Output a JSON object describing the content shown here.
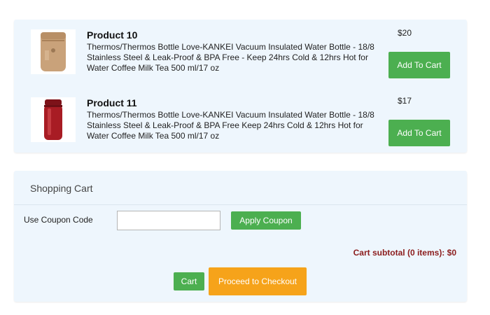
{
  "products": [
    {
      "name": "Product 10",
      "description": "Thermos/Thermos Bottle Love-KANKEI Vacuum Insulated Water Bottle - 18/8 Stainless Steel & Leak-Proof & BPA Free - Keep 24hrs Cold & 12hrs Hot for Water Coffee Milk Tea 500 ml/17 oz",
      "price": "$20",
      "add_label": "Add To Cart",
      "image_icon": "thermos-jar-icon",
      "image_color": "#c9a27a"
    },
    {
      "name": "Product 11",
      "description": "Thermos/Thermos Bottle Love-KANKEI Vacuum Insulated Water Bottle - 18/8 Stainless Steel & Leak-Proof & BPA Free   Keep 24hrs Cold & 12hrs Hot for Water Coffee Milk Tea 500 ml/17 oz",
      "price": "$17",
      "add_label": "Add To Cart",
      "image_icon": "thermos-bottle-icon",
      "image_color": "#a81c24"
    }
  ],
  "cart": {
    "title": "Shopping Cart",
    "coupon_label": "Use Coupon Code",
    "coupon_value": "",
    "coupon_placeholder": "",
    "apply_label": "Apply Coupon",
    "subtotal": "Cart subtotal (0 items): $0",
    "cart_label": "Cart",
    "checkout_label": "Proceed to Checkout"
  },
  "colors": {
    "panel_bg": "#eef6fd",
    "green_button": "#4caf50",
    "checkout_button": "#f6a31a",
    "subtotal_text": "#8b1c1c"
  }
}
